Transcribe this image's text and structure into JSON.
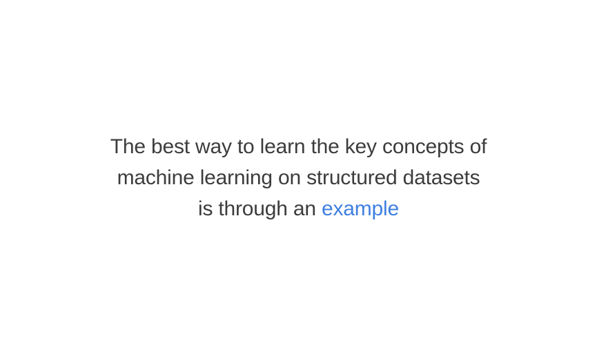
{
  "headline": {
    "line1": "The best way to learn the key concepts of",
    "line2": "machine learning on structured datasets",
    "line3_prefix": "is through an",
    "line3_highlight": "example"
  },
  "colors": {
    "background": "#ffffff",
    "text": "#3c3c3c",
    "accent": "#3f7fe0"
  }
}
